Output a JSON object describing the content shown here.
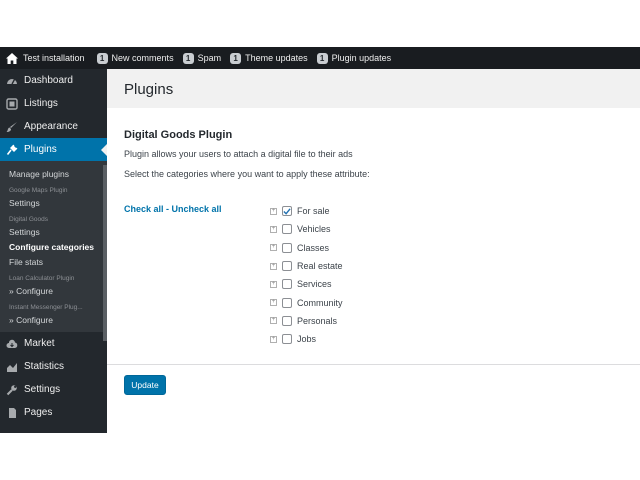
{
  "topbar": {
    "site_name": "Test installation",
    "items": [
      {
        "count": "1",
        "label": "New comments"
      },
      {
        "count": "1",
        "label": "Spam"
      },
      {
        "count": "1",
        "label": "Theme updates"
      },
      {
        "count": "1",
        "label": "Plugin updates"
      }
    ]
  },
  "sidebar": {
    "items_top": [
      {
        "label": "Dashboard",
        "icon": "dashboard-icon"
      },
      {
        "label": "Listings",
        "icon": "listings-icon"
      },
      {
        "label": "Appearance",
        "icon": "appearance-icon"
      },
      {
        "label": "Plugins",
        "icon": "plugins-icon",
        "active": true
      }
    ],
    "submenu": {
      "manage": "Manage plugins",
      "gmaps_head": "Google Maps Plugin",
      "gmaps_link": "Settings",
      "dg_head": "Digital Goods",
      "dg_settings": "Settings",
      "dg_configure": "Configure categories",
      "dg_filestats": "File stats",
      "loan_head": "Loan Calculator Plugin",
      "loan_link": "» Configure",
      "im_head": "Instant Messenger Plug...",
      "im_link": "» Configure"
    },
    "items_bottom": [
      {
        "label": "Market",
        "icon": "cloud-icon"
      },
      {
        "label": "Statistics",
        "icon": "chart-icon"
      },
      {
        "label": "Settings",
        "icon": "wrench-icon"
      },
      {
        "label": "Pages",
        "icon": "pages-icon"
      }
    ]
  },
  "main": {
    "page_title": "Plugins",
    "plugin_title": "Digital Goods Plugin",
    "plugin_desc": "Plugin allows your users to attach a digital file to their ads",
    "plugin_sub": "Select the categories where you want to apply these attribute:",
    "check_all": "Check all",
    "separator": " - ",
    "uncheck_all": "Uncheck all",
    "categories": [
      {
        "label": "For sale",
        "checked": true
      },
      {
        "label": "Vehicles",
        "checked": false
      },
      {
        "label": "Classes",
        "checked": false
      },
      {
        "label": "Real estate",
        "checked": false
      },
      {
        "label": "Services",
        "checked": false
      },
      {
        "label": "Community",
        "checked": false
      },
      {
        "label": "Personals",
        "checked": false
      },
      {
        "label": "Jobs",
        "checked": false
      }
    ],
    "update_label": "Update"
  },
  "colors": {
    "admin_bar": "#191c20",
    "sidebar": "#23282d",
    "accent": "#0073aa"
  }
}
